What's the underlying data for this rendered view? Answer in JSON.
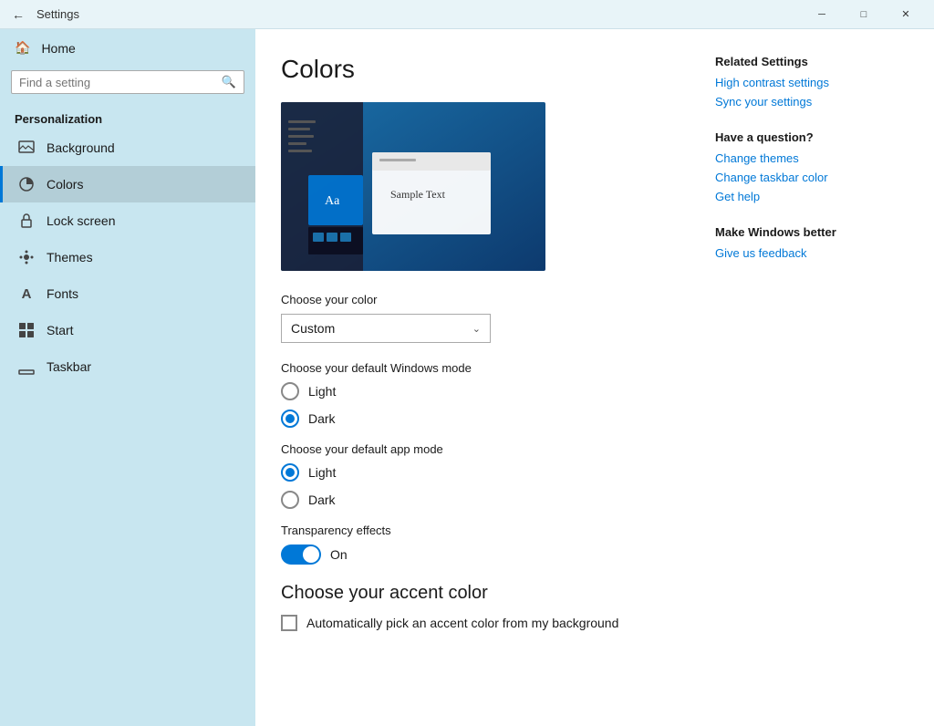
{
  "titlebar": {
    "back_label": "←",
    "title": "Settings",
    "minimize_label": "─",
    "maximize_label": "□",
    "close_label": "✕"
  },
  "sidebar": {
    "home_label": "Home",
    "search_placeholder": "Find a setting",
    "section_title": "Personalization",
    "items": [
      {
        "id": "background",
        "label": "Background",
        "icon": "🖼"
      },
      {
        "id": "colors",
        "label": "Colors",
        "icon": "🎨",
        "active": true
      },
      {
        "id": "lock-screen",
        "label": "Lock screen",
        "icon": "🔒"
      },
      {
        "id": "themes",
        "label": "Themes",
        "icon": "🎭"
      },
      {
        "id": "fonts",
        "label": "Fonts",
        "icon": "A"
      },
      {
        "id": "start",
        "label": "Start",
        "icon": "⊞"
      },
      {
        "id": "taskbar",
        "label": "Taskbar",
        "icon": "▬"
      }
    ]
  },
  "main": {
    "page_title": "Colors",
    "choose_color_label": "Choose your color",
    "color_dropdown_value": "Custom",
    "color_dropdown_arrow": "⌄",
    "windows_mode_label": "Choose your default Windows mode",
    "windows_mode_options": [
      {
        "id": "light-win",
        "label": "Light",
        "checked": false
      },
      {
        "id": "dark-win",
        "label": "Dark",
        "checked": true
      }
    ],
    "app_mode_label": "Choose your default app mode",
    "app_mode_options": [
      {
        "id": "light-app",
        "label": "Light",
        "checked": true
      },
      {
        "id": "dark-app",
        "label": "Dark",
        "checked": false
      }
    ],
    "transparency_label": "Transparency effects",
    "transparency_state": "On",
    "accent_title": "Choose your accent color",
    "accent_checkbox_label": "Automatically pick an accent color from my background"
  },
  "related": {
    "title": "Related Settings",
    "links": [
      "High contrast settings",
      "Sync your settings"
    ],
    "question_title": "Have a question?",
    "question_links": [
      "Change themes",
      "Change taskbar color",
      "Get help"
    ],
    "better_title": "Make Windows better",
    "better_links": [
      "Give us feedback"
    ]
  }
}
